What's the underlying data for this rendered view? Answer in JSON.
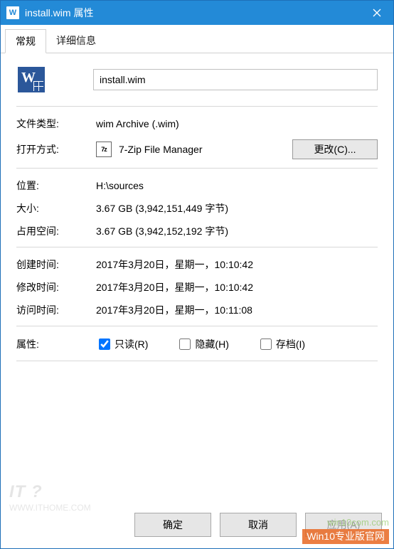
{
  "titlebar": {
    "icon_text": "W",
    "title": "install.wim 属性"
  },
  "tabs": {
    "general": "常规",
    "details": "详细信息"
  },
  "file": {
    "name": "install.wim",
    "type_label": "文件类型:",
    "type_value": "wim Archive (.wim)",
    "open_with_label": "打开方式:",
    "open_with_app": "7-Zip File Manager",
    "open_with_icon_text": "7z",
    "change_button": "更改(C)...",
    "location_label": "位置:",
    "location_value": "H:\\sources",
    "size_label": "大小:",
    "size_value": "3.67 GB (3,942,151,449 字节)",
    "size_on_disk_label": "占用空间:",
    "size_on_disk_value": "3.67 GB (3,942,152,192 字节)",
    "created_label": "创建时间:",
    "created_value": "2017年3月20日，星期一，10:10:42",
    "modified_label": "修改时间:",
    "modified_value": "2017年3月20日，星期一，10:10:42",
    "accessed_label": "访问时间:",
    "accessed_value": "2017年3月20日，星期一，10:11:08",
    "attributes_label": "属性:",
    "attr_readonly": "只读(R)",
    "attr_hidden": "隐藏(H)",
    "attr_archive": "存档(I)"
  },
  "footer": {
    "ok": "确定",
    "cancel": "取消",
    "apply": "应用(A)"
  },
  "watermark": {
    "left_logo": "IT ?",
    "left_url": "WWW.ITHOME.COM",
    "right_url": "win10com.com",
    "right_bar": "Win10专业版官网"
  }
}
